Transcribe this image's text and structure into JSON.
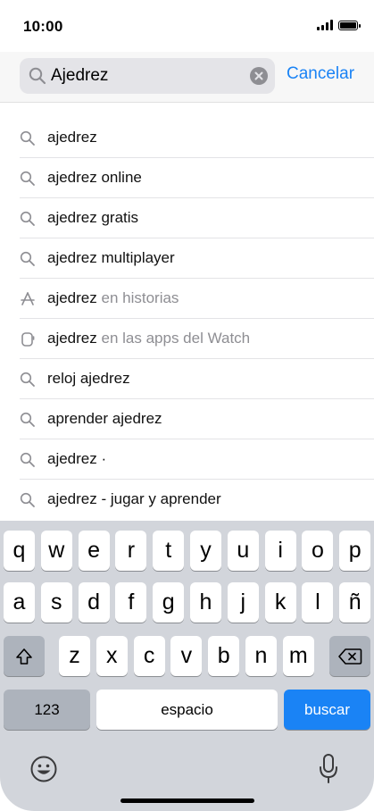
{
  "status": {
    "time": "10:00"
  },
  "search": {
    "value": "Ajedrez",
    "cancel_label": "Cancelar"
  },
  "suggestions": [
    {
      "text": "ajedrez",
      "sub": "",
      "icon": "search-icon"
    },
    {
      "text": "ajedrez online",
      "sub": "",
      "icon": "search-icon"
    },
    {
      "text": "ajedrez gratis",
      "sub": "",
      "icon": "search-icon"
    },
    {
      "text": "ajedrez multiplayer",
      "sub": "",
      "icon": "search-icon"
    },
    {
      "text": "ajedrez",
      "sub": " en historias",
      "icon": "app-store-icon"
    },
    {
      "text": "ajedrez",
      "sub": " en las apps del Watch",
      "icon": "watch-icon"
    },
    {
      "text": "reloj ajedrez",
      "sub": "",
      "icon": "search-icon"
    },
    {
      "text": "aprender ajedrez",
      "sub": "",
      "icon": "search-icon"
    },
    {
      "text": "ajedrez ·",
      "sub": "",
      "icon": "search-icon"
    },
    {
      "text": "ajedrez - jugar y aprender",
      "sub": "",
      "icon": "search-icon"
    }
  ],
  "keyboard": {
    "row1": [
      "q",
      "w",
      "e",
      "r",
      "t",
      "y",
      "u",
      "i",
      "o",
      "p"
    ],
    "row2": [
      "a",
      "s",
      "d",
      "f",
      "g",
      "h",
      "j",
      "k",
      "l",
      "ñ"
    ],
    "row3": [
      "z",
      "x",
      "c",
      "v",
      "b",
      "n",
      "m"
    ],
    "numbers_label": "123",
    "space_label": "espacio",
    "search_label": "buscar",
    "shift_icon": "shift-icon",
    "delete_icon": "delete-icon",
    "emoji_icon": "emoji-icon",
    "mic_icon": "microphone-icon"
  }
}
